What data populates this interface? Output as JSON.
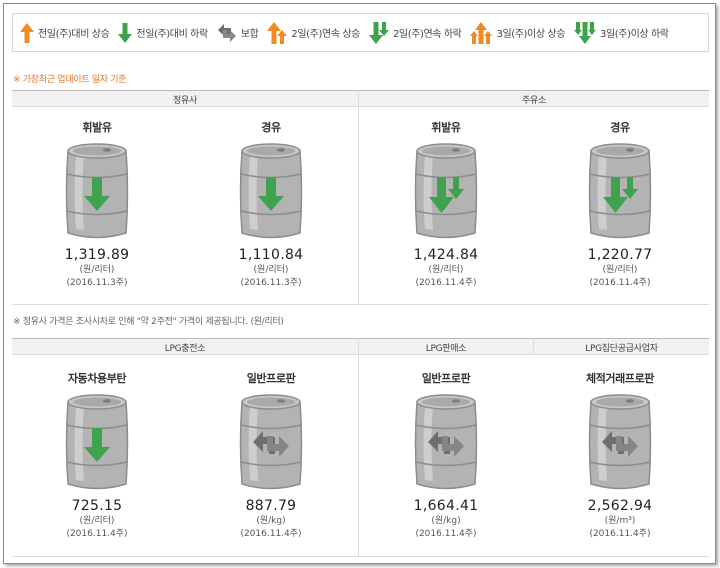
{
  "legend": [
    {
      "icon": "up-arrow-icon",
      "label": "전일(주)대비 상승"
    },
    {
      "icon": "down-arrow-icon",
      "label": "전일(주)대비 하락"
    },
    {
      "icon": "mixed-arrows-icon",
      "label": "보합"
    },
    {
      "icon": "double-up-arrow-icon",
      "label": "2일(주)연속 상승"
    },
    {
      "icon": "double-down-arrow-icon",
      "label": "2일(주)연속 하락"
    },
    {
      "icon": "triple-up-arrow-icon",
      "label": "3일(주)이상 상승"
    },
    {
      "icon": "triple-down-arrow-icon",
      "label": "3일(주)이상 하락"
    }
  ],
  "notes": {
    "top": "※ 가장최근 업데이트 일자 기준",
    "middle": "※ 정유사 가격은 조사시차로 인해 \"약 2주전\" 가격이 제공됩니다. (원/리터)"
  },
  "sections": {
    "refinery": "정유사",
    "gas_station": "주유소",
    "lpg_station": "LPG충전소",
    "lpg_retail": "LPG판매소",
    "lpg_bulk": "LPG집단공급사업자"
  },
  "cards": [
    {
      "title": "휘발유",
      "price": "1,319.89",
      "unit": "(원/리터)",
      "date": "(2016.11.3주)",
      "icon": "down-arrow-icon"
    },
    {
      "title": "경유",
      "price": "1,110.84",
      "unit": "(원/리터)",
      "date": "(2016.11.3주)",
      "icon": "down-arrow-icon"
    },
    {
      "title": "휘발유",
      "price": "1,424.84",
      "unit": "(원/리터)",
      "date": "(2016.11.4주)",
      "icon": "double-down-arrow-icon"
    },
    {
      "title": "경유",
      "price": "1,220.77",
      "unit": "(원/리터)",
      "date": "(2016.11.4주)",
      "icon": "double-down-arrow-icon"
    },
    {
      "title": "자동차용부탄",
      "price": "725.15",
      "unit": "(원/리터)",
      "date": "(2016.11.4주)",
      "icon": "down-arrow-icon"
    },
    {
      "title": "일반프로판",
      "price": "887.79",
      "unit": "(원/kg)",
      "date": "(2016.11.4주)",
      "icon": "mixed-arrows-icon"
    },
    {
      "title": "일반프로판",
      "price": "1,664.41",
      "unit": "(원/kg)",
      "date": "(2016.11.4주)",
      "icon": "mixed-arrows-icon"
    },
    {
      "title": "체적거래프로판",
      "price": "2,562.94",
      "unit": "(원/m³)",
      "date": "(2016.11.4주)",
      "icon": "mixed-arrows-icon"
    }
  ],
  "colors": {
    "up": "#f08a24",
    "down": "#3fa34d",
    "flat": "#6e6e6e",
    "barrel": "#b8b8b8"
  }
}
